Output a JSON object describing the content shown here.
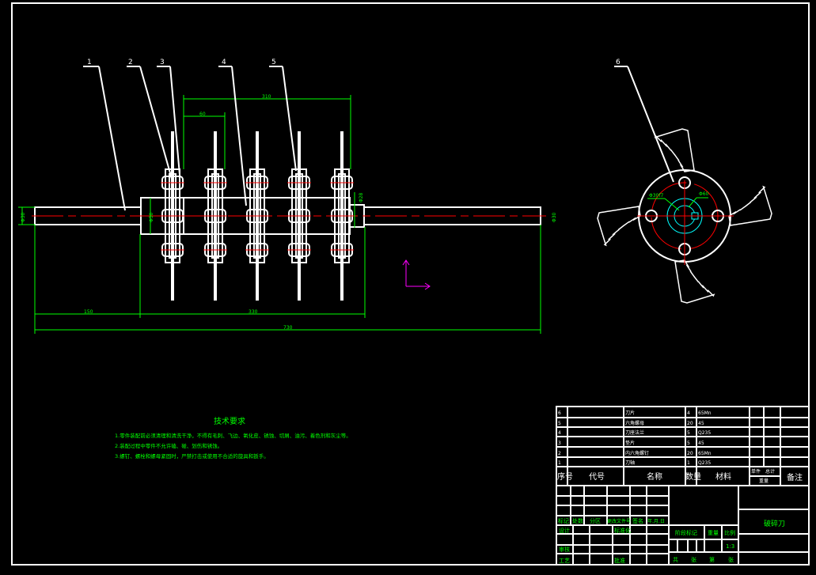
{
  "drawing": {
    "balloons": [
      "1",
      "2",
      "3",
      "4",
      "5",
      "6"
    ],
    "dimensions": {
      "disc_span": "310",
      "disc_pitch": "60",
      "left_shaft_len": "150",
      "body_len": "330",
      "total_len": "730",
      "left_shaft_dia": "Φ30",
      "hub_dia": "Φ50",
      "right_step_dia": "Φ28",
      "right_shaft_dia": "Φ30",
      "bore_fit": "Φ30f7",
      "bore_outer": "Φ60"
    }
  },
  "technical_requirements": {
    "title": "技术要求",
    "items": [
      "1.零件装配前必须清理和清洗干净，不得有毛刺、飞边、氧化皮、锈蚀、切屑、油污、着色剂和灰尘等。",
      "2.装配过程中零件不允许磕、碰、划伤和锈蚀。",
      "3.螺钉、螺栓和螺母紧固时，严禁打击或使用不合适的旋具和扳手。"
    ]
  },
  "parts_list": {
    "rows": [
      {
        "no": "6",
        "code": "",
        "name": "刀片",
        "qty": "4",
        "material": "65Mn"
      },
      {
        "no": "5",
        "code": "",
        "name": "六角螺母",
        "qty": "20",
        "material": "45"
      },
      {
        "no": "4",
        "code": "",
        "name": "刀座法兰",
        "qty": "5",
        "material": "Q235"
      },
      {
        "no": "3",
        "code": "",
        "name": "垫片",
        "qty": "5",
        "material": "45"
      },
      {
        "no": "2",
        "code": "",
        "name": "内六角螺钉",
        "qty": "20",
        "material": "65Mn"
      },
      {
        "no": "1",
        "code": "",
        "name": "刀轴",
        "qty": "1",
        "material": "Q235"
      }
    ],
    "headers": {
      "no": "序号",
      "code": "代号",
      "name": "名称",
      "qty": "数量",
      "material": "材料",
      "unit": "单件",
      "total": "总计",
      "weight": "重量",
      "remark": "备注"
    }
  },
  "title_block": {
    "title": "破碎刀",
    "mark": "标记",
    "count": "处数",
    "zone": "分区",
    "change_doc": "更改文件号",
    "signature": "签名",
    "date": "年.月.日",
    "design": "设计",
    "standardize": "标准化",
    "review": "审核",
    "process": "工艺",
    "approve": "批准",
    "stage_mark": "阶段标记",
    "weight": "重量",
    "scale": "比例",
    "scale_value": "1:3",
    "total_sheets": "共",
    "sheet": "张",
    "sheet_no": "第",
    "sheet2": "张"
  },
  "colors": {
    "outline": "#ffffff",
    "dimension": "#00ff00",
    "centerline": "#ff0000",
    "hatch": "#00ffff",
    "background": "#000000"
  }
}
